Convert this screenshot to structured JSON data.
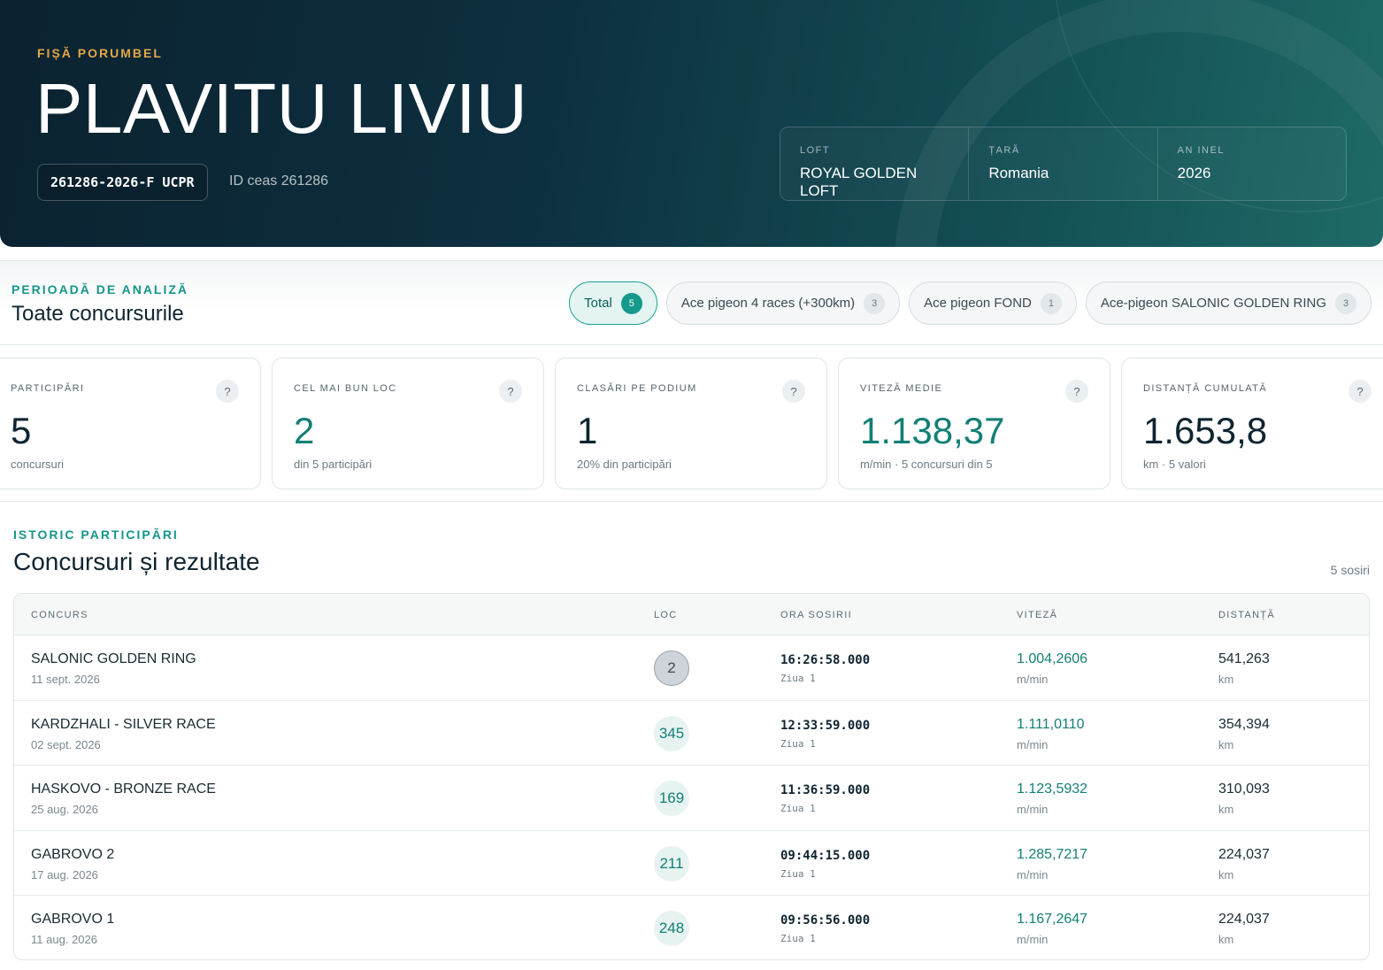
{
  "hero": {
    "eyebrow": "FIȘĂ PORUMBEL",
    "owner": "PLAVITU LIVIU",
    "ring": "261286-2026-F UCPR",
    "clock_id": "ID ceas 261286",
    "meta": [
      {
        "label": "LOFT",
        "value": "ROYAL GOLDEN LOFT"
      },
      {
        "label": "ȚARĂ",
        "value": "Romania"
      },
      {
        "label": "AN INEL",
        "value": "2026"
      }
    ]
  },
  "period": {
    "eyebrow": "PERIOADĂ DE ANALIZĂ",
    "title": "Toate concursurile",
    "filters": [
      {
        "label": "Total",
        "count": "5",
        "active": true
      },
      {
        "label": "Ace pigeon 4 races (+300km)",
        "count": "3",
        "active": false
      },
      {
        "label": "Ace pigeon FOND",
        "count": "1",
        "active": false
      },
      {
        "label": "Ace-pigeon SALONIC GOLDEN RING",
        "count": "3",
        "active": false
      }
    ]
  },
  "stats": [
    {
      "label": "PARTICIPĂRI",
      "value": "5",
      "sub": "concursuri",
      "help": "?"
    },
    {
      "label": "CEL MAI BUN LOC",
      "value": "2",
      "sub": "din 5 participări",
      "help": "?"
    },
    {
      "label": "CLASĂRI PE PODIUM",
      "value": "1",
      "sub": "20% din participări",
      "help": "?"
    },
    {
      "label": "VITEZĂ MEDIE",
      "value": "1.138,37",
      "sub": "m/min · 5 concursuri din 5",
      "help": "?"
    },
    {
      "label": "DISTANȚĂ CUMULATĂ",
      "value": "1.653,8",
      "sub": "km · 5 valori",
      "help": "?"
    }
  ],
  "history": {
    "eyebrow": "ISTORIC PARTICIPĂRI",
    "title": "Concursuri și rezultate",
    "count": "5 sosiri",
    "columns": {
      "race": "CONCURS",
      "place": "LOC",
      "arrival": "ORA SOSIRII",
      "speed": "VITEZĂ",
      "distance": "DISTANȚĂ"
    },
    "rows": [
      {
        "name": "SALONIC GOLDEN RING",
        "date": "11 sept. 2026",
        "place": "2",
        "time": "16:26:58.000",
        "day": "Ziua 1",
        "speed": "1.004,2606",
        "speed_unit": "m/min",
        "distance": "541,263",
        "distance_unit": "km"
      },
      {
        "name": "KARDZHALI - SILVER RACE",
        "date": "02 sept. 2026",
        "place": "345",
        "time": "12:33:59.000",
        "day": "Ziua 1",
        "speed": "1.111,0110",
        "speed_unit": "m/min",
        "distance": "354,394",
        "distance_unit": "km"
      },
      {
        "name": "HASKOVO - BRONZE RACE",
        "date": "25 aug. 2026",
        "place": "169",
        "time": "11:36:59.000",
        "day": "Ziua 1",
        "speed": "1.123,5932",
        "speed_unit": "m/min",
        "distance": "310,093",
        "distance_unit": "km"
      },
      {
        "name": "GABROVO 2",
        "date": "17 aug. 2026",
        "place": "211",
        "time": "09:44:15.000",
        "day": "Ziua 1",
        "speed": "1.285,7217",
        "speed_unit": "m/min",
        "distance": "224,037",
        "distance_unit": "km"
      },
      {
        "name": "GABROVO 1",
        "date": "11 aug. 2026",
        "place": "248",
        "time": "09:56:56.000",
        "day": "Ziua 1",
        "speed": "1.167,2647",
        "speed_unit": "m/min",
        "distance": "224,037",
        "distance_unit": "km"
      }
    ]
  }
}
